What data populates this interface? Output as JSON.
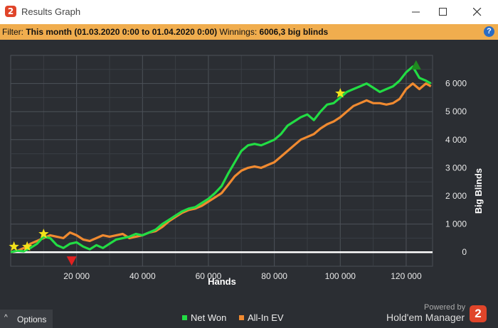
{
  "window": {
    "app_icon_text": "2",
    "title": "Results Graph"
  },
  "filter": {
    "label": "Filter:",
    "value": "This month (01.03.2020 0:00 to 01.04.2020 0:00)",
    "winnings_label": "Winnings:",
    "winnings_value": "6006,3 big blinds",
    "help_text": "?"
  },
  "footer": {
    "options_label": "Options",
    "powered_by": "Powered by",
    "brand": "Hold'em Manager",
    "brand_logo_text": "2"
  },
  "colors": {
    "net_won": "#22dd44",
    "all_in_ev": "#f08a30",
    "background": "#2b2e33",
    "filter_bar": "#f0ad4e"
  },
  "chart_data": {
    "type": "line",
    "xlabel": "Hands",
    "ylabel": "Big Blinds",
    "xlim": [
      0,
      128000
    ],
    "ylim": [
      -500,
      7000
    ],
    "xticks": [
      {
        "value": 20000,
        "label": "20 000"
      },
      {
        "value": 40000,
        "label": "40 000"
      },
      {
        "value": 60000,
        "label": "60 000"
      },
      {
        "value": 80000,
        "label": "80 000"
      },
      {
        "value": 100000,
        "label": "100 000"
      },
      {
        "value": 120000,
        "label": "120 000"
      }
    ],
    "yticks": [
      {
        "value": 0,
        "label": "0"
      },
      {
        "value": 1000,
        "label": "1 000"
      },
      {
        "value": 2000,
        "label": "2 000"
      },
      {
        "value": 3000,
        "label": "3 000"
      },
      {
        "value": 4000,
        "label": "4 000"
      },
      {
        "value": 5000,
        "label": "5 000"
      },
      {
        "value": 6000,
        "label": "6 000"
      }
    ],
    "grid": true,
    "legend_position": "bottom-center",
    "series": [
      {
        "name": "Net Won",
        "color": "#22dd44",
        "x": [
          0,
          2000,
          4000,
          6000,
          8000,
          10000,
          12000,
          14000,
          16000,
          18000,
          20000,
          22000,
          24000,
          26000,
          28000,
          30000,
          32000,
          34000,
          36000,
          38000,
          40000,
          42000,
          44000,
          46000,
          48000,
          50000,
          52000,
          54000,
          56000,
          58000,
          60000,
          62000,
          64000,
          66000,
          68000,
          70000,
          72000,
          74000,
          76000,
          78000,
          80000,
          82000,
          84000,
          86000,
          88000,
          90000,
          92000,
          94000,
          96000,
          98000,
          100000,
          102000,
          104000,
          106000,
          108000,
          110000,
          112000,
          114000,
          116000,
          118000,
          120000,
          122000,
          124000,
          126000,
          127500
        ],
        "y": [
          0,
          50,
          30,
          150,
          300,
          550,
          500,
          250,
          150,
          300,
          350,
          200,
          100,
          250,
          150,
          300,
          450,
          500,
          550,
          650,
          600,
          700,
          800,
          1000,
          1150,
          1300,
          1450,
          1550,
          1600,
          1750,
          1900,
          2100,
          2350,
          2800,
          3200,
          3600,
          3800,
          3850,
          3800,
          3900,
          4000,
          4200,
          4500,
          4650,
          4800,
          4900,
          4700,
          5000,
          5250,
          5300,
          5500,
          5700,
          5800,
          5900,
          6000,
          5850,
          5700,
          5800,
          5900,
          6100,
          6400,
          6600,
          6200,
          6100,
          6000
        ]
      },
      {
        "name": "All-In EV",
        "color": "#f08a30",
        "x": [
          0,
          2000,
          4000,
          6000,
          8000,
          10000,
          12000,
          14000,
          16000,
          18000,
          20000,
          22000,
          24000,
          26000,
          28000,
          30000,
          32000,
          34000,
          36000,
          38000,
          40000,
          42000,
          44000,
          46000,
          48000,
          50000,
          52000,
          54000,
          56000,
          58000,
          60000,
          62000,
          64000,
          66000,
          68000,
          70000,
          72000,
          74000,
          76000,
          78000,
          80000,
          82000,
          84000,
          86000,
          88000,
          90000,
          92000,
          94000,
          96000,
          98000,
          100000,
          102000,
          104000,
          106000,
          108000,
          110000,
          112000,
          114000,
          116000,
          118000,
          120000,
          122000,
          124000,
          126000,
          127500
        ],
        "y": [
          0,
          50,
          150,
          300,
          400,
          500,
          600,
          550,
          500,
          700,
          600,
          450,
          400,
          500,
          600,
          550,
          600,
          650,
          500,
          550,
          600,
          700,
          750,
          900,
          1100,
          1250,
          1400,
          1500,
          1550,
          1650,
          1800,
          1950,
          2100,
          2400,
          2700,
          2900,
          3000,
          3050,
          3000,
          3100,
          3200,
          3400,
          3600,
          3800,
          4000,
          4100,
          4200,
          4400,
          4550,
          4650,
          4800,
          5000,
          5200,
          5300,
          5400,
          5300,
          5300,
          5250,
          5300,
          5450,
          5800,
          6000,
          5800,
          6000,
          5900
        ]
      }
    ],
    "markers": [
      {
        "type": "max",
        "shape": "triangle-up",
        "color": "#1f8a1f",
        "x": 123000,
        "y": 6650
      },
      {
        "type": "min",
        "shape": "triangle-down",
        "color": "#e02020",
        "x": 18500,
        "y": -300
      },
      {
        "type": "event",
        "shape": "star",
        "color": "#f3e21a",
        "x": 1000,
        "y": 200
      },
      {
        "type": "event",
        "shape": "star",
        "color": "#f3e21a",
        "x": 5000,
        "y": 200
      },
      {
        "type": "event",
        "shape": "star",
        "color": "#f3e21a",
        "x": 10000,
        "y": 650
      },
      {
        "type": "event",
        "shape": "star",
        "color": "#f3e21a",
        "x": 100000,
        "y": 5650
      }
    ]
  }
}
